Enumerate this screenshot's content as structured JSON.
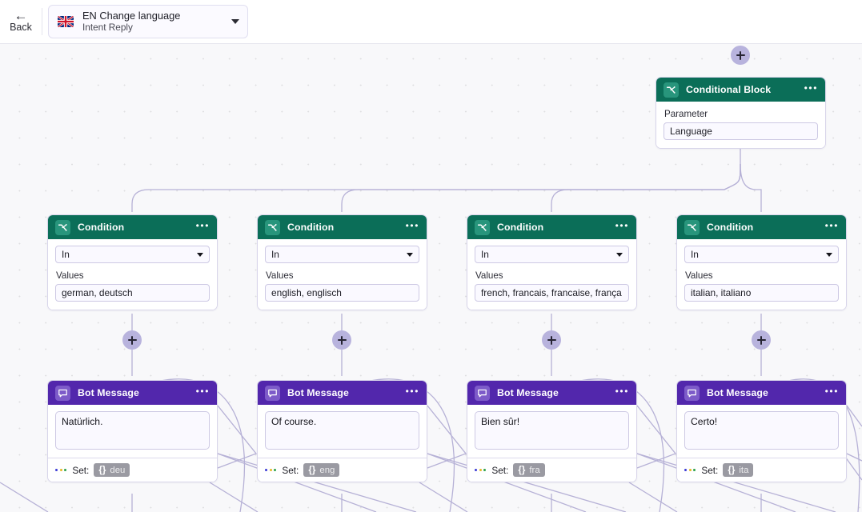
{
  "topbar": {
    "back_label": "Back",
    "back_icon": "arrow-left-icon",
    "intent": {
      "flag_icon": "uk-flag-icon",
      "title": "EN Change language",
      "subtitle": "Intent Reply",
      "caret_icon": "chevron-down-icon"
    }
  },
  "colors": {
    "condition_header": "#0b6e58",
    "condition_icon": "#28957c",
    "bot_header": "#5227ac",
    "bot_icon": "#7d5bc9",
    "edge": "#b6b1d6",
    "plus_button": "#b8b3dd",
    "canvas": "#f8f8fa",
    "chip": "#9a9aa2",
    "dot_blue": "#3b3bd6",
    "dot_yellow": "#e6b824",
    "dot_green": "#2aa14a"
  },
  "canvas": {
    "conditional_block": {
      "title": "Conditional Block",
      "icon": "branch-icon",
      "menu_icon": "more-options-icon",
      "parameter_label": "Parameter",
      "parameter_value": "Language"
    },
    "add_button_label": "+",
    "conditions": [
      {
        "title": "Condition",
        "icon": "branch-icon",
        "menu_icon": "more-options-icon",
        "operator": "In",
        "values_label": "Values",
        "values": "german, deutsch"
      },
      {
        "title": "Condition",
        "icon": "branch-icon",
        "menu_icon": "more-options-icon",
        "operator": "In",
        "values_label": "Values",
        "values": "english, englisch"
      },
      {
        "title": "Condition",
        "icon": "branch-icon",
        "menu_icon": "more-options-icon",
        "operator": "In",
        "values_label": "Values",
        "values": "french, francais, francaise, frança"
      },
      {
        "title": "Condition",
        "icon": "branch-icon",
        "menu_icon": "more-options-icon",
        "operator": "In",
        "values_label": "Values",
        "values": "italian, italiano"
      }
    ],
    "bot_messages": [
      {
        "title": "Bot Message",
        "icon": "speech-bubble-icon",
        "menu_icon": "more-options-icon",
        "message": "Natürlich.",
        "set_label": "Set:",
        "variable_brace": "{}",
        "variable_name": "deu"
      },
      {
        "title": "Bot Message",
        "icon": "speech-bubble-icon",
        "menu_icon": "more-options-icon",
        "message": "Of course.",
        "set_label": "Set:",
        "variable_brace": "{}",
        "variable_name": "eng"
      },
      {
        "title": "Bot Message",
        "icon": "speech-bubble-icon",
        "menu_icon": "more-options-icon",
        "message": "Bien sûr!",
        "set_label": "Set:",
        "variable_brace": "{}",
        "variable_name": "fra"
      },
      {
        "title": "Bot Message",
        "icon": "speech-bubble-icon",
        "menu_icon": "more-options-icon",
        "message": "Certo!",
        "set_label": "Set:",
        "variable_brace": "{}",
        "variable_name": "ita"
      }
    ]
  }
}
